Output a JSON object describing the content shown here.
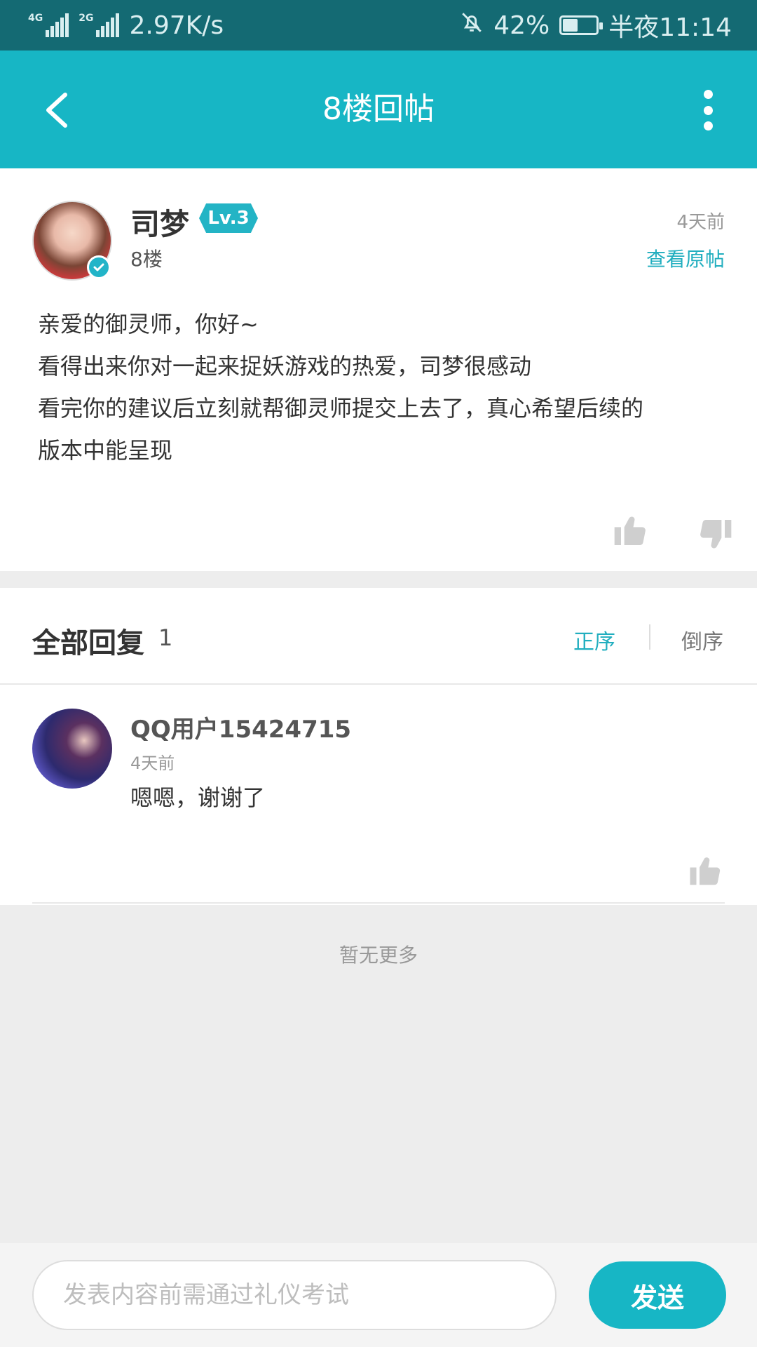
{
  "status_bar": {
    "network_1": "4G",
    "network_2": "2G",
    "speed": "2.97K/s",
    "battery_percent": "42%",
    "time": "半夜11:14"
  },
  "header": {
    "title": "8楼回帖"
  },
  "post": {
    "author": "司梦",
    "level": "Lv.3",
    "floor": "8楼",
    "time": "4天前",
    "view_original": "查看原帖",
    "lines": [
      "亲爱的御灵师，你好~",
      "看得出来你对一起来捉妖游戏的热爱，司梦很感动",
      "看完你的建议后立刻就帮御灵师提交上去了，真心希望后续的",
      "版本中能呈现"
    ]
  },
  "replies": {
    "title": "全部回复",
    "count": "1",
    "sort_asc": "正序",
    "sort_desc": "倒序",
    "items": [
      {
        "user": "QQ用户15424715",
        "time": "4天前",
        "text": "嗯嗯，谢谢了"
      }
    ]
  },
  "no_more": "暂无更多",
  "composer": {
    "placeholder": "发表内容前需通过礼仪考试",
    "send_label": "发送"
  },
  "colors": {
    "accent": "#17b6c5",
    "status_bar": "#146a73",
    "link": "#21aebf"
  },
  "icons": [
    "back-arrow-icon",
    "more-vertical-icon",
    "verified-icon",
    "thumb-up-icon",
    "thumb-down-icon",
    "mute-bell-icon",
    "battery-icon",
    "signal-icon"
  ]
}
